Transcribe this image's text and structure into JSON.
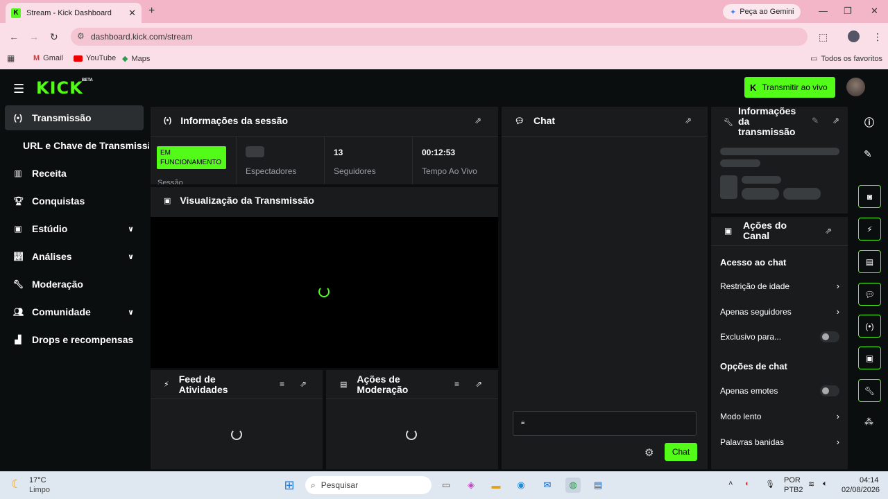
{
  "browser": {
    "tab_title": "Stream - Kick Dashboard",
    "tab_favicon": "K",
    "new_tab": "+",
    "gemini_label": "Peça ao Gemini",
    "url": "dashboard.kick.com/stream",
    "bookmarks": [
      {
        "label": "Gmail",
        "icon": "gmail-icon"
      },
      {
        "label": "YouTube",
        "icon": "youtube-icon"
      },
      {
        "label": "Maps",
        "icon": "maps-icon"
      }
    ],
    "all_favorites": "Todos os favoritos"
  },
  "header": {
    "logo": "KICK",
    "beta": "BETA",
    "go_live": "Transmitir ao vivo"
  },
  "sidebar": {
    "items": [
      {
        "label": "Transmissão",
        "icon": "broadcast-icon"
      },
      {
        "label": "URL e Chave de Transmissão"
      },
      {
        "label": "Receita",
        "icon": "revenue-icon"
      },
      {
        "label": "Conquistas",
        "icon": "trophy-icon"
      },
      {
        "label": "Estúdio",
        "icon": "studio-icon"
      },
      {
        "label": "Análises",
        "icon": "analytics-icon"
      },
      {
        "label": "Moderação",
        "icon": "wrench-icon"
      },
      {
        "label": "Comunidade",
        "icon": "community-icon"
      },
      {
        "label": "Drops e recompensas",
        "icon": "drops-icon"
      }
    ]
  },
  "session": {
    "title": "Informações da sessão",
    "status_badge": "EM FUNCIONAMENTO",
    "session_label": "Sessão",
    "viewers_label": "Espectadores",
    "followers_value": "13",
    "followers_label": "Seguidores",
    "time_value": "00:12:53",
    "time_label": "Tempo Ao Vivo"
  },
  "preview": {
    "title": "Visualização da Transmissão"
  },
  "activity_feed": {
    "title": "Feed de Atividades"
  },
  "mod_actions": {
    "title": "Ações de Moderação"
  },
  "chat": {
    "title": "Chat",
    "send_label": "Chat"
  },
  "stream_info": {
    "title": "Informações da transmissão"
  },
  "channel_actions": {
    "title": "Ações do Canal",
    "chat_access_heading": "Acesso ao chat",
    "age_restriction": "Restrição de idade",
    "followers_only": "Apenas seguidores",
    "exclusive_for": "Exclusivo para...",
    "chat_options_heading": "Opções de chat",
    "emotes_only": "Apenas emotes",
    "slow_mode": "Modo lento",
    "banned_words": "Palavras banidas"
  },
  "taskbar": {
    "temperature": "17°C",
    "weather": "Limpo",
    "search_placeholder": "Pesquisar",
    "language": "POR",
    "layout": "PTB2",
    "time": "04:14",
    "date": "02/08/2026"
  },
  "colors": {
    "accent": "#53fc18",
    "panel": "#191b1c",
    "background": "#0b0e0f"
  }
}
